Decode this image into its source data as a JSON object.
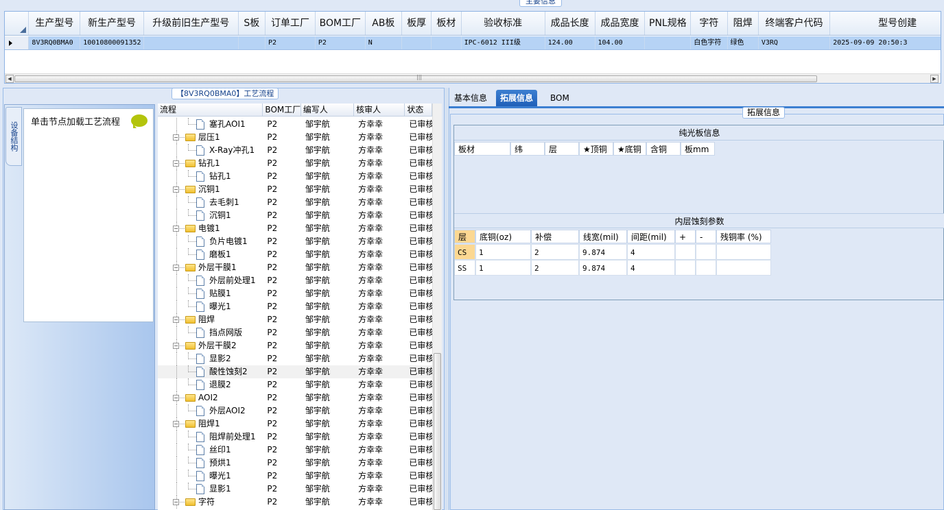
{
  "top": {
    "title": "主要信息",
    "columns": [
      "生产型号",
      "新生产型号",
      "升级前旧生产型号",
      "S板",
      "订单工厂",
      "BOM工厂",
      "AB板",
      "板厚",
      "板材",
      "验收标准",
      "成品长度",
      "成品宽度",
      "PNL规格",
      "字符",
      "阻焊",
      "终端客户代码",
      "型号创建"
    ],
    "row": [
      "8V3RQ0BMA0",
      "10010800091352",
      "",
      "",
      "P2",
      "P2",
      "N",
      "",
      "",
      "IPC-6012 III级",
      "124.00",
      "104.00",
      "",
      "白色字符",
      "绿色",
      "V3RQ",
      "2025-09-09 20:50:3"
    ]
  },
  "left": {
    "title": "【8V3RQ0BMA0】工艺流程",
    "vtab": "设备结构",
    "load_hint": "单击节点加载工艺流程",
    "tree_columns": [
      "流程",
      "BOM工厂",
      "编写人",
      "核审人",
      "状态"
    ],
    "tree_rows": [
      {
        "name": "塞孔AOI1",
        "level": 1,
        "bom": "P2",
        "writer": "邹宇航",
        "reviewer": "方幸幸",
        "status": "已审核"
      },
      {
        "name": "层压1",
        "level": 0,
        "bom": "P2",
        "writer": "邹宇航",
        "reviewer": "方幸幸",
        "status": "已审核"
      },
      {
        "name": "X-Ray冲孔1",
        "level": 1,
        "bom": "P2",
        "writer": "邹宇航",
        "reviewer": "方幸幸",
        "status": "已审核"
      },
      {
        "name": "钻孔1",
        "level": 0,
        "bom": "P2",
        "writer": "邹宇航",
        "reviewer": "方幸幸",
        "status": "已审核"
      },
      {
        "name": "钻孔1",
        "level": 1,
        "bom": "P2",
        "writer": "邹宇航",
        "reviewer": "方幸幸",
        "status": "已审核"
      },
      {
        "name": "沉铜1",
        "level": 0,
        "bom": "P2",
        "writer": "邹宇航",
        "reviewer": "方幸幸",
        "status": "已审核"
      },
      {
        "name": "去毛刺1",
        "level": 1,
        "bom": "P2",
        "writer": "邹宇航",
        "reviewer": "方幸幸",
        "status": "已审核"
      },
      {
        "name": "沉铜1",
        "level": 1,
        "bom": "P2",
        "writer": "邹宇航",
        "reviewer": "方幸幸",
        "status": "已审核"
      },
      {
        "name": "电镀1",
        "level": 0,
        "bom": "P2",
        "writer": "邹宇航",
        "reviewer": "方幸幸",
        "status": "已审核"
      },
      {
        "name": "负片电镀1",
        "level": 1,
        "bom": "P2",
        "writer": "邹宇航",
        "reviewer": "方幸幸",
        "status": "已审核"
      },
      {
        "name": "磨板1",
        "level": 1,
        "bom": "P2",
        "writer": "邹宇航",
        "reviewer": "方幸幸",
        "status": "已审核"
      },
      {
        "name": "外层干膜1",
        "level": 0,
        "bom": "P2",
        "writer": "邹宇航",
        "reviewer": "方幸幸",
        "status": "已审核"
      },
      {
        "name": "外层前处理1",
        "level": 1,
        "bom": "P2",
        "writer": "邹宇航",
        "reviewer": "方幸幸",
        "status": "已审核"
      },
      {
        "name": "贴膜1",
        "level": 1,
        "bom": "P2",
        "writer": "邹宇航",
        "reviewer": "方幸幸",
        "status": "已审核"
      },
      {
        "name": "曝光1",
        "level": 1,
        "bom": "P2",
        "writer": "邹宇航",
        "reviewer": "方幸幸",
        "status": "已审核"
      },
      {
        "name": "阻焊",
        "level": 0,
        "bom": "P2",
        "writer": "邹宇航",
        "reviewer": "方幸幸",
        "status": "已审核"
      },
      {
        "name": "挡点网版",
        "level": 1,
        "bom": "P2",
        "writer": "邹宇航",
        "reviewer": "方幸幸",
        "status": "已审核"
      },
      {
        "name": "外层干膜2",
        "level": 0,
        "bom": "P2",
        "writer": "邹宇航",
        "reviewer": "方幸幸",
        "status": "已审核"
      },
      {
        "name": "显影2",
        "level": 1,
        "bom": "P2",
        "writer": "邹宇航",
        "reviewer": "方幸幸",
        "status": "已审核"
      },
      {
        "name": "酸性蚀刻2",
        "level": 1,
        "bom": "P2",
        "writer": "邹宇航",
        "reviewer": "方幸幸",
        "status": "已审核",
        "selected": true
      },
      {
        "name": "退膜2",
        "level": 1,
        "bom": "P2",
        "writer": "邹宇航",
        "reviewer": "方幸幸",
        "status": "已审核"
      },
      {
        "name": "AOI2",
        "level": 0,
        "bom": "P2",
        "writer": "邹宇航",
        "reviewer": "方幸幸",
        "status": "已审核"
      },
      {
        "name": "外层AOI2",
        "level": 1,
        "bom": "P2",
        "writer": "邹宇航",
        "reviewer": "方幸幸",
        "status": "已审核"
      },
      {
        "name": "阻焊1",
        "level": 0,
        "bom": "P2",
        "writer": "邹宇航",
        "reviewer": "方幸幸",
        "status": "已审核"
      },
      {
        "name": "阻焊前处理1",
        "level": 1,
        "bom": "P2",
        "writer": "邹宇航",
        "reviewer": "方幸幸",
        "status": "已审核"
      },
      {
        "name": "丝印1",
        "level": 1,
        "bom": "P2",
        "writer": "邹宇航",
        "reviewer": "方幸幸",
        "status": "已审核"
      },
      {
        "name": "预烘1",
        "level": 1,
        "bom": "P2",
        "writer": "邹宇航",
        "reviewer": "方幸幸",
        "status": "已审核"
      },
      {
        "name": "曝光1",
        "level": 1,
        "bom": "P2",
        "writer": "邹宇航",
        "reviewer": "方幸幸",
        "status": "已审核"
      },
      {
        "name": "显影1",
        "level": 1,
        "bom": "P2",
        "writer": "邹宇航",
        "reviewer": "方幸幸",
        "status": "已审核"
      },
      {
        "name": "字符",
        "level": 0,
        "bom": "P2",
        "writer": "邹宇航",
        "reviewer": "方幸幸",
        "status": "已审核"
      }
    ]
  },
  "right": {
    "tabs": [
      {
        "label": "基本信息",
        "active": false
      },
      {
        "label": "拓展信息",
        "active": true
      },
      {
        "label": "BOM",
        "active": false
      }
    ],
    "ext_title": "拓展信息",
    "light_title": "纯光板信息",
    "light_columns": [
      "板材",
      "纬",
      "层",
      "★顶铜",
      "★底铜",
      "含铜",
      "板mm"
    ],
    "etch_title": "内层蚀刻参数",
    "etch_columns": [
      "层",
      "底铜(oz)",
      "补偿",
      "线宽(mil)",
      "间距(mil)",
      "+",
      "-",
      "残铜率 (%)"
    ],
    "etch_rows": [
      [
        "CS",
        "1",
        "2",
        "9.874",
        "4",
        "",
        "",
        ""
      ],
      [
        "SS",
        "1",
        "2",
        "9.874",
        "4",
        "",
        "",
        ""
      ]
    ]
  },
  "colors": {
    "selected_row": "#b6d3f5",
    "active_tab": "#2a6cc4",
    "orange_cell": "#fcd892"
  }
}
